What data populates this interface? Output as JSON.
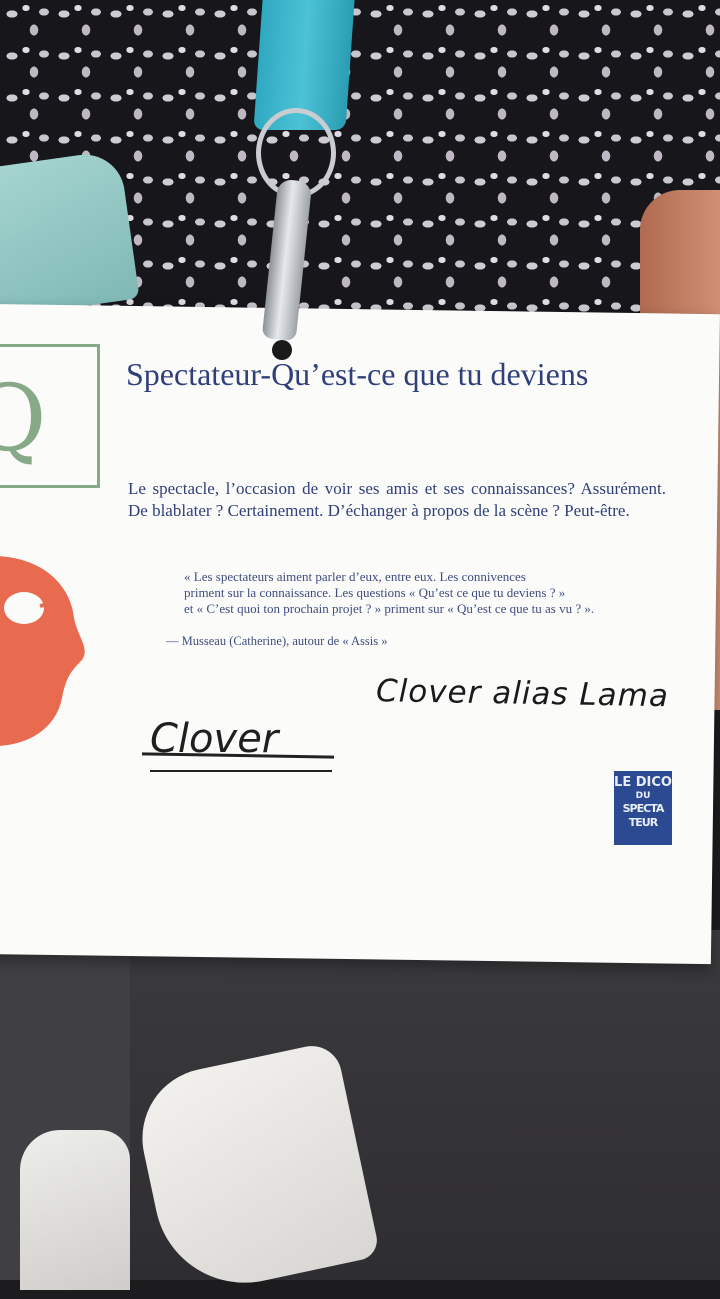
{
  "card": {
    "letter": "Q",
    "title": "Spectateur-Qu’est-ce que tu deviens",
    "body": "Le spectacle, l’occasion de voir ses amis et ses connaissances? Assurément. De blablater ? Certainement. D’échanger à propos de la scène ? Peut-être.",
    "quote_lines": [
      "« Les spectateurs aiment parler d’eux, entre eux. Les connivences",
      "priment sur la connaissance. Les questions « Qu’est ce que tu deviens ? »",
      "et « C’est quoi ton prochain projet ? » priment sur « Qu’est ce que tu as vu ? »."
    ],
    "attribution": "— Musseau (Catherine), autour de « Assis »",
    "handwriting_main": "Clover alias Lama",
    "handwriting_crossed": "Clover",
    "stamp": {
      "line1": "LE DICO",
      "line2": "DU",
      "line3": "SPECTA",
      "line4": "TEUR"
    }
  },
  "colors": {
    "ink_blue": "#2f3f7a",
    "letter_green": "#87a987",
    "mascot_red": "#e86a4f",
    "strap_cyan": "#3fb8cd",
    "stamp_blue": "#2c4a91"
  }
}
